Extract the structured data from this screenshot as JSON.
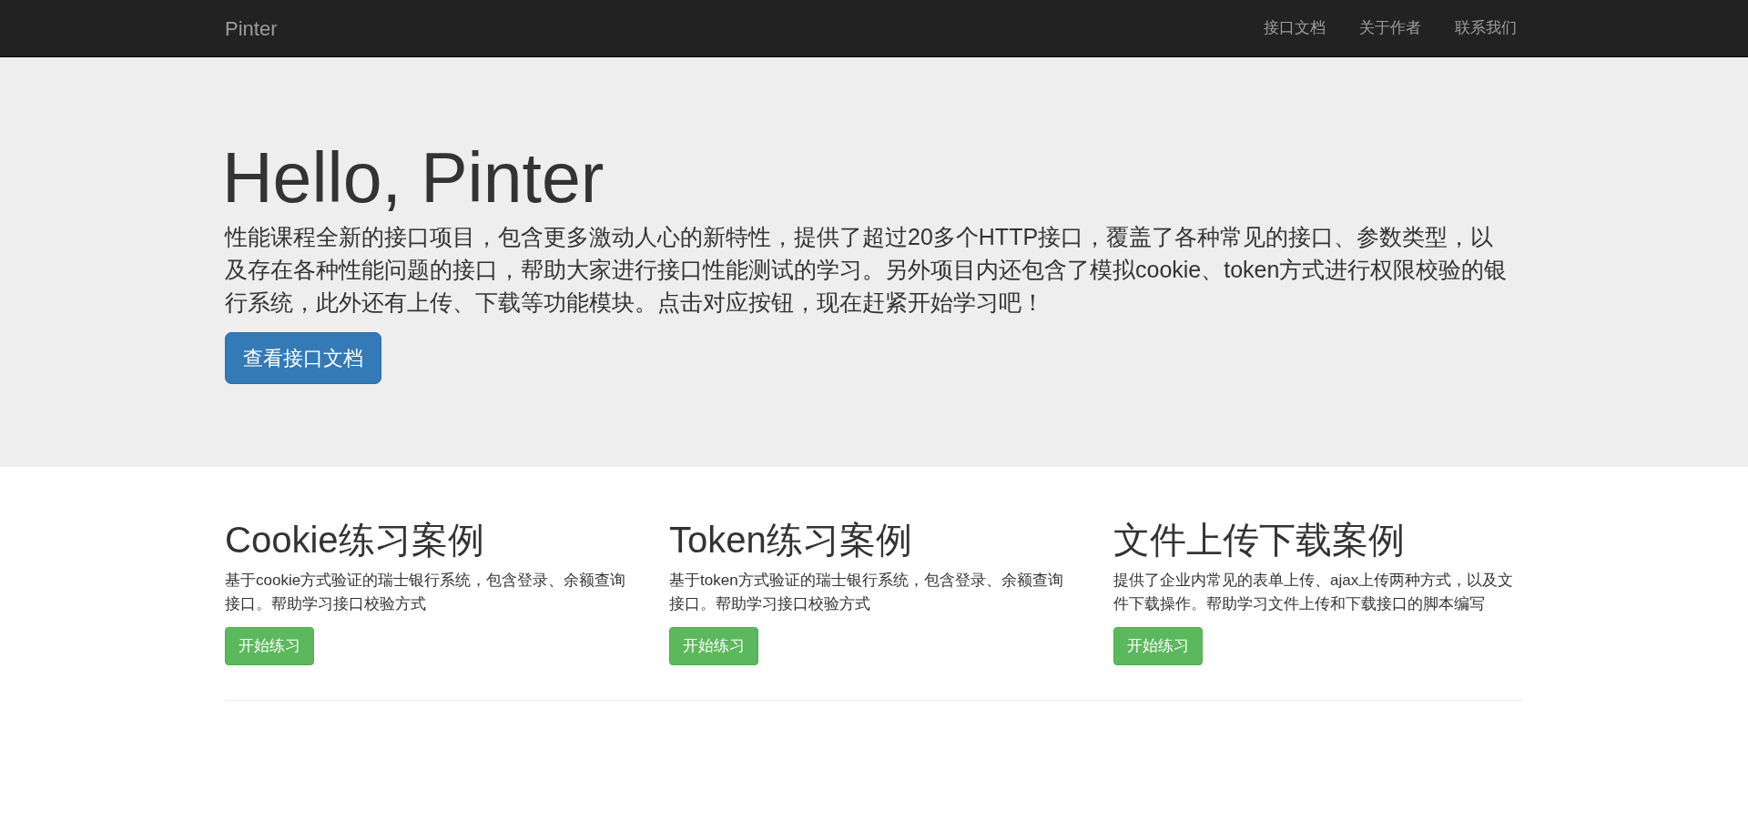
{
  "navbar": {
    "brand": "Pinter",
    "links": [
      {
        "label": "接口文档"
      },
      {
        "label": "关于作者"
      },
      {
        "label": "联系我们"
      }
    ]
  },
  "jumbotron": {
    "title": "Hello, Pinter",
    "text": "性能课程全新的接口项目，包含更多激动人心的新特性，提供了超过20多个HTTP接口，覆盖了各种常见的接口、参数类型，以及存在各种性能问题的接口，帮助大家进行接口性能测试的学习。另外项目内还包含了模拟cookie、token方式进行权限校验的银行系统，此外还有上传、下载等功能模块。点击对应按钮，现在赶紧开始学习吧！",
    "button": "查看接口文档"
  },
  "cards": [
    {
      "title": "Cookie练习案例",
      "text": "基于cookie方式验证的瑞士银行系统，包含登录、余额查询接口。帮助学习接口校验方式",
      "button": "开始练习"
    },
    {
      "title": "Token练习案例",
      "text": "基于token方式验证的瑞士银行系统，包含登录、余额查询接口。帮助学习接口校验方式",
      "button": "开始练习"
    },
    {
      "title": "文件上传下载案例",
      "text": "提供了企业内常见的表单上传、ajax上传两种方式，以及文件下载操作。帮助学习文件上传和下载接口的脚本编写",
      "button": "开始练习"
    }
  ]
}
